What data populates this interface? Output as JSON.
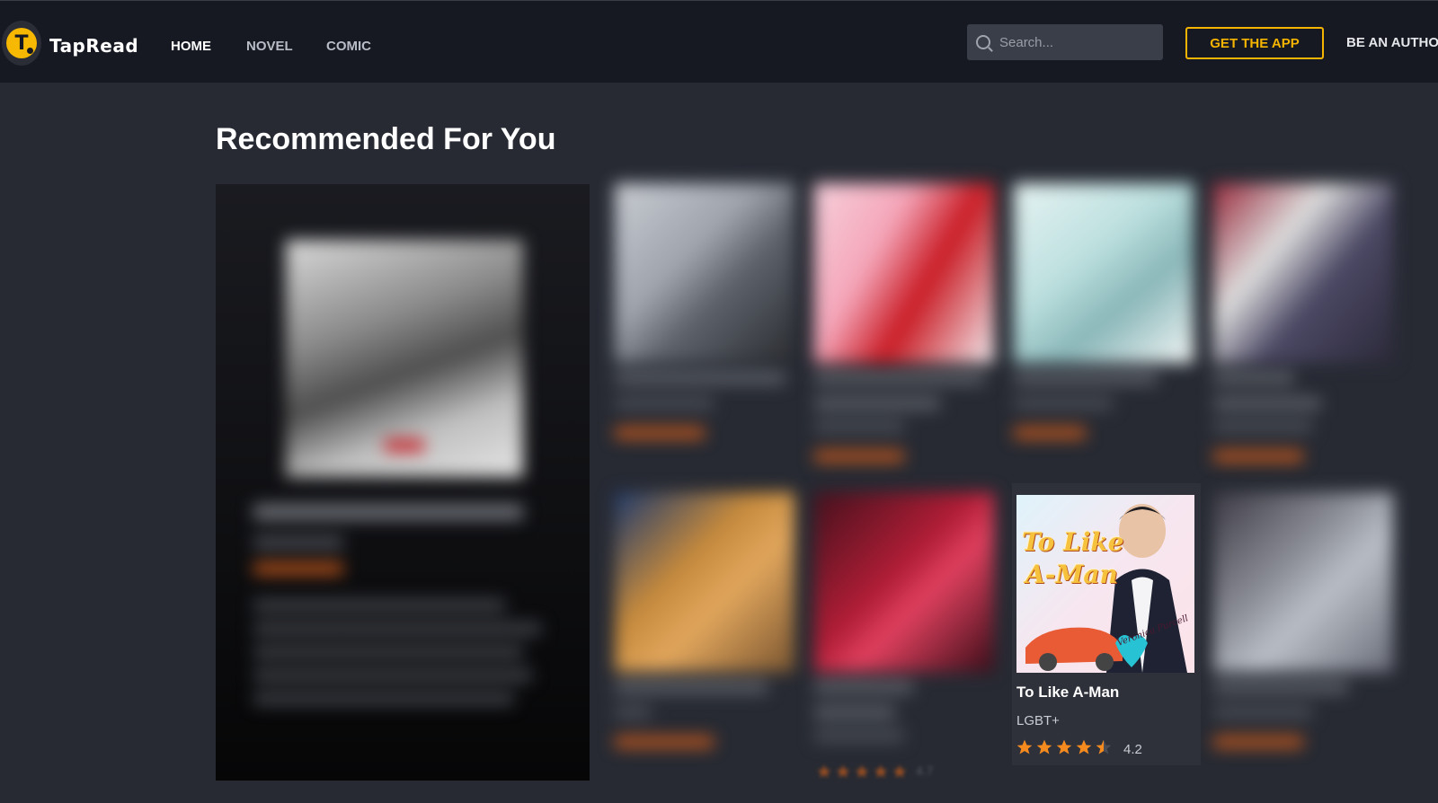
{
  "header": {
    "brand": "TapRead",
    "nav": [
      "HOME",
      "NOVEL",
      "COMIC"
    ],
    "active_nav": "HOME",
    "search_placeholder": "Search...",
    "get_app_label": "GET THE APP",
    "author_label": "BE AN AUTHO",
    "icons": [
      "logo-icon",
      "search-icon"
    ]
  },
  "main": {
    "section_title": "Recommended For You",
    "highlighted_book": {
      "cover_title_line1": "To Like",
      "cover_title_line2": "A-Man",
      "cover_badge": "Veronica Purcell",
      "title": "To Like A-Man",
      "genre": "LGBT+",
      "rating": "4.2",
      "stars": 4.2
    },
    "blurred_rating": "4.7"
  },
  "colors": {
    "header_bg": "#161922",
    "page_bg": "#272a33",
    "accent": "#f5b400",
    "star": "#f58a1f"
  }
}
